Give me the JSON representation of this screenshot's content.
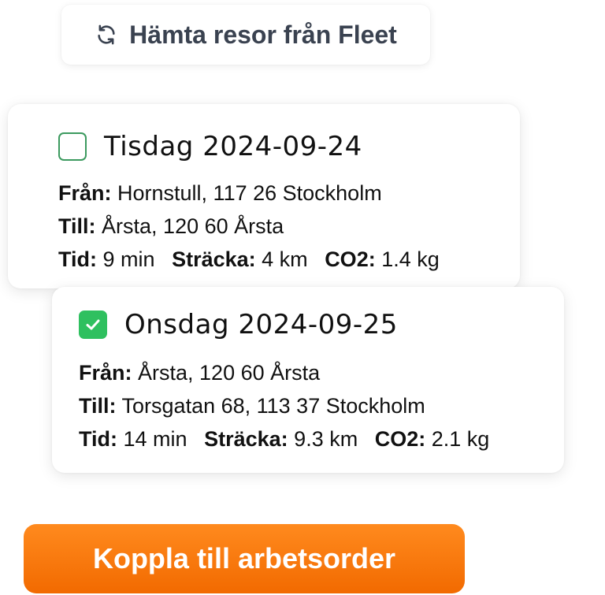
{
  "fetch_button": {
    "label": "Hämta resor från Fleet",
    "icon": "refresh-icon"
  },
  "trips": [
    {
      "checked": false,
      "date": "Tisdag 2024-09-24",
      "from_label": "Från:",
      "from": "Hornstull, 117 26 Stockholm",
      "to_label": "Till:",
      "to": "Årsta, 120 60 Årsta",
      "time_label": "Tid:",
      "time": "9 min",
      "distance_label": "Sträcka:",
      "distance": "4 km",
      "co2_label": "CO2:",
      "co2": "1.4 kg"
    },
    {
      "checked": true,
      "date": "Onsdag 2024-09-25",
      "from_label": "Från:",
      "from": "Årsta, 120 60 Årsta",
      "to_label": "Till:",
      "to": "Torsgatan 68, 113 37 Stockholm",
      "time_label": "Tid:",
      "time": "14 min",
      "distance_label": "Sträcka:",
      "distance": "9.3 km",
      "co2_label": "CO2:",
      "co2": "2.1 kg"
    }
  ],
  "cta_button": {
    "label": "Koppla till arbetsorder"
  },
  "colors": {
    "accent_orange": "#f47a10",
    "check_green": "#2fc05f",
    "checkbox_border": "#3c9a5f",
    "button_text": "#3a4250"
  }
}
